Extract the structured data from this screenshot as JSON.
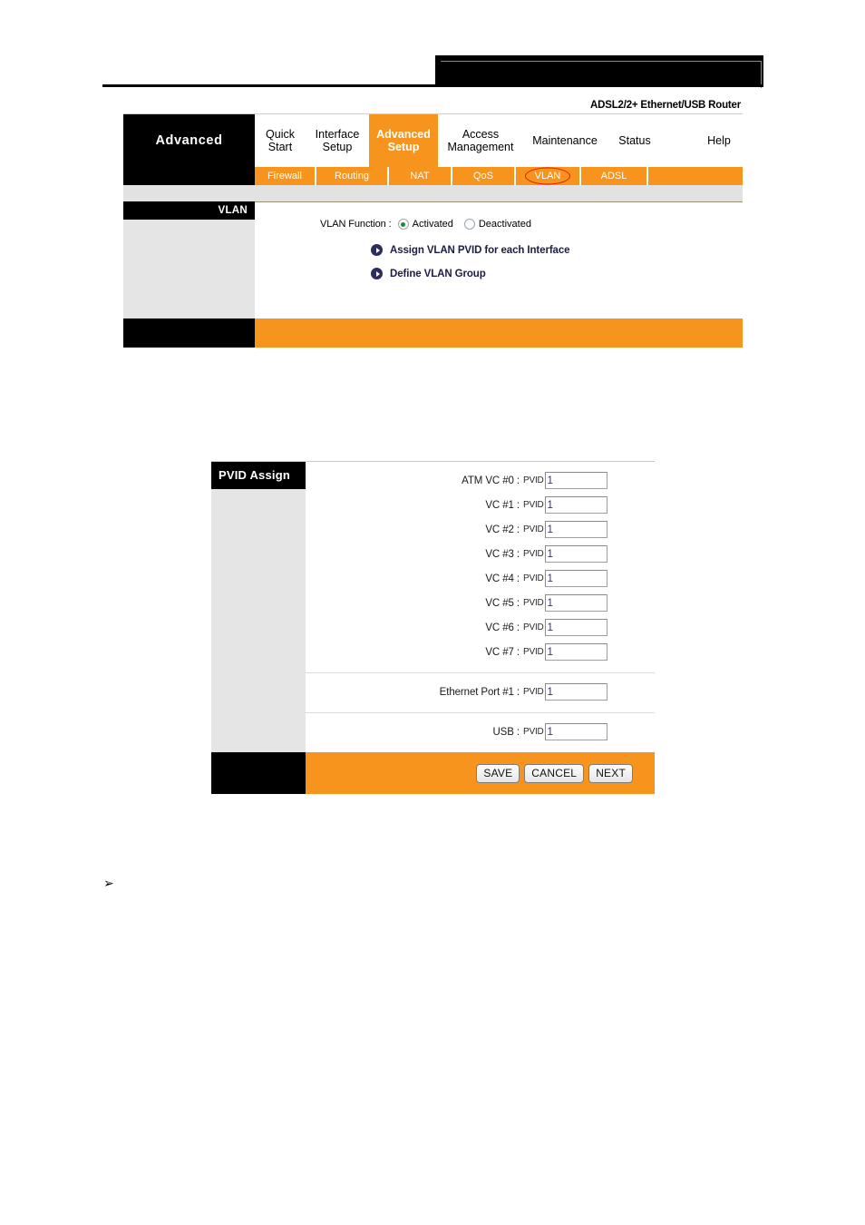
{
  "document": {
    "model_label": "ADSL2/2+ Ethernet/USB Router",
    "bottom_bullet": "➢"
  },
  "router_ui": {
    "brand_label": "Advanced",
    "main_tabs": [
      {
        "label": "Quick\nStart",
        "active": false
      },
      {
        "label": "Interface\nSetup",
        "active": false
      },
      {
        "label": "Advanced\nSetup",
        "active": true
      },
      {
        "label": "Access\nManagement",
        "active": false
      },
      {
        "label": "Maintenance",
        "active": false
      },
      {
        "label": "Status",
        "active": false
      },
      {
        "label": "Help",
        "active": false
      }
    ],
    "sub_tabs": [
      {
        "label": "Firewall",
        "annotated": false
      },
      {
        "label": "Routing",
        "annotated": false
      },
      {
        "label": "NAT",
        "annotated": false
      },
      {
        "label": "QoS",
        "annotated": false
      },
      {
        "label": "VLAN",
        "annotated": true
      },
      {
        "label": "ADSL",
        "annotated": false
      }
    ],
    "annotation_color": "#E01B00",
    "accent_color": "#F7941E",
    "vlan_panel": {
      "section_title": "VLAN",
      "function_label": "VLAN Function :",
      "radio_activated": "Activated",
      "radio_deactivated": "Deactivated",
      "selected": "Activated",
      "links": [
        "Assign VLAN PVID for each Interface",
        "Define VLAN Group"
      ]
    }
  },
  "pvid_ui": {
    "section_title": "PVID Assign",
    "pvid_tag": "PVID",
    "groups": [
      {
        "rows": [
          {
            "label": "ATM VC #0 :",
            "value": "1"
          },
          {
            "label": "VC #1 :",
            "value": "1"
          },
          {
            "label": "VC #2 :",
            "value": "1"
          },
          {
            "label": "VC #3 :",
            "value": "1"
          },
          {
            "label": "VC #4 :",
            "value": "1"
          },
          {
            "label": "VC #5 :",
            "value": "1"
          },
          {
            "label": "VC #6 :",
            "value": "1"
          },
          {
            "label": "VC #7 :",
            "value": "1"
          }
        ]
      },
      {
        "rows": [
          {
            "label": "Ethernet Port #1 :",
            "value": "1"
          }
        ]
      },
      {
        "rows": [
          {
            "label": "USB :",
            "value": "1"
          }
        ]
      }
    ],
    "buttons": [
      {
        "label": "SAVE"
      },
      {
        "label": "CANCEL"
      },
      {
        "label": "NEXT"
      }
    ]
  }
}
